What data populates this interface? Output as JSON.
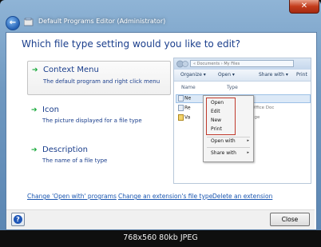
{
  "window": {
    "title": "Default Programs Editor (Administrator)",
    "close_glyph": "✕",
    "back_glyph": "←"
  },
  "heading": "Which file type setting would you like to edit?",
  "options": [
    {
      "title": "Context Menu",
      "description": "The default program and right click menu",
      "selected": true
    },
    {
      "title": "Icon",
      "description": "The picture displayed for a file type",
      "selected": false
    },
    {
      "title": "Description",
      "description": "The name of a file type",
      "selected": false
    }
  ],
  "option_arrow": "➔",
  "preview": {
    "address": "« Documents › My Files",
    "toolbar": {
      "organize": "Organize ▾",
      "open": "Open ▾",
      "share": "Share with ▾",
      "print": "Print"
    },
    "columns": {
      "name": "Name",
      "type": "Type"
    },
    "rows": [
      "Ne",
      "Re",
      "Va"
    ],
    "row_info": [
      "Office Doc",
      "nge"
    ],
    "context_menu": [
      "Open",
      "Edit",
      "New",
      "Print",
      "Open with",
      "Share with"
    ],
    "submenu_glyph": "▸"
  },
  "links": [
    "Change 'Open with' programs",
    "Change an extension's file type",
    "Delete an extension"
  ],
  "footer": {
    "help_glyph": "?",
    "close_label": "Close"
  },
  "caption": "768x560 80kb JPEG",
  "colors": {
    "link": "#1a56b0",
    "heading": "#1a3e8c",
    "arrow": "#17a93a",
    "highlight": "#c0392b"
  }
}
